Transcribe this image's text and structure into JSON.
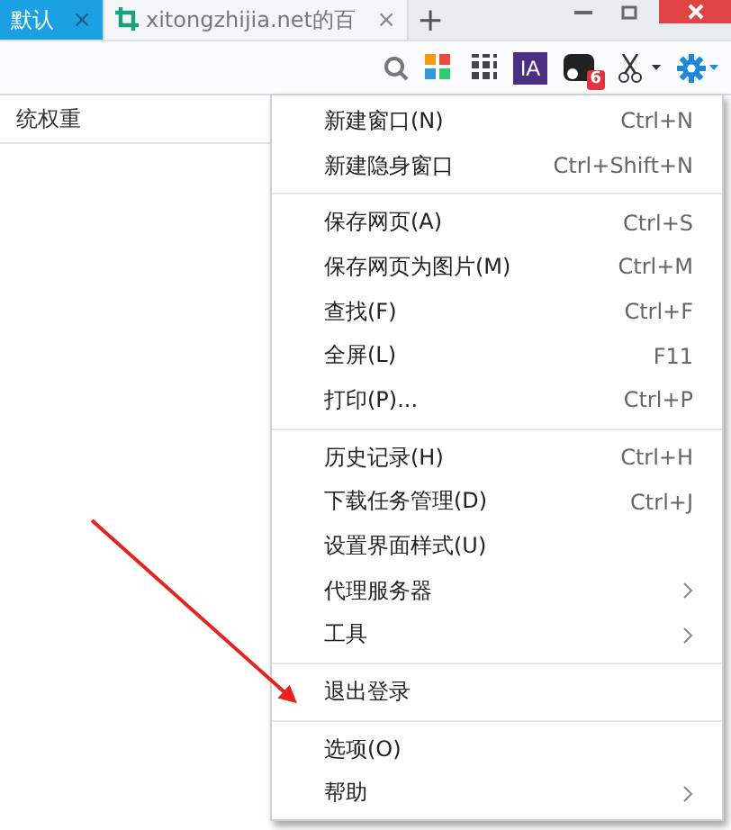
{
  "tabs": [
    {
      "label": "默认",
      "selected": true,
      "close": "×"
    },
    {
      "label": "xitongzhijia.net的百",
      "selected": false,
      "close": "×"
    }
  ],
  "new_tab": "+",
  "toolbar": {
    "ia_logo": "IA",
    "badge": "6"
  },
  "page": {
    "row_label": "统权重"
  },
  "menu": [
    {
      "kind": "item",
      "label": "新建窗口(N)",
      "shortcut": "Ctrl+N",
      "submenu": false
    },
    {
      "kind": "item",
      "label": "新建隐身窗口",
      "shortcut": "Ctrl+Shift+N",
      "submenu": false
    },
    {
      "kind": "separator"
    },
    {
      "kind": "item",
      "label": "保存网页(A)",
      "shortcut": "Ctrl+S",
      "submenu": false
    },
    {
      "kind": "item",
      "label": "保存网页为图片(M)",
      "shortcut": "Ctrl+M",
      "submenu": false
    },
    {
      "kind": "item",
      "label": "查找(F)",
      "shortcut": "Ctrl+F",
      "submenu": false
    },
    {
      "kind": "item",
      "label": "全屏(L)",
      "shortcut": "F11",
      "submenu": false
    },
    {
      "kind": "item",
      "label": "打印(P)...",
      "shortcut": "Ctrl+P",
      "submenu": false
    },
    {
      "kind": "separator"
    },
    {
      "kind": "item",
      "label": "历史记录(H)",
      "shortcut": "Ctrl+H",
      "submenu": false
    },
    {
      "kind": "item",
      "label": "下载任务管理(D)",
      "shortcut": "Ctrl+J",
      "submenu": false
    },
    {
      "kind": "item",
      "label": "设置界面样式(U)",
      "submenu": false
    },
    {
      "kind": "item",
      "label": "代理服务器",
      "submenu": true
    },
    {
      "kind": "item",
      "label": "工具",
      "submenu": true
    },
    {
      "kind": "separator"
    },
    {
      "kind": "item",
      "label": "退出登录",
      "submenu": false
    },
    {
      "kind": "separator"
    },
    {
      "kind": "item",
      "label": "选项(O)",
      "submenu": false
    },
    {
      "kind": "item",
      "label": "帮助",
      "submenu": true
    }
  ]
}
